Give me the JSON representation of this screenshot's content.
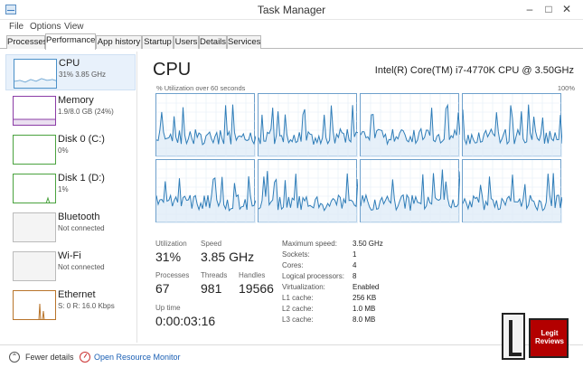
{
  "window": {
    "title": "Task Manager",
    "controls": {
      "minimize": "–",
      "maximize": "□",
      "close": "✕"
    }
  },
  "menu": [
    "File",
    "Options",
    "View"
  ],
  "tabs": [
    "Processes",
    "Performance",
    "App history",
    "Startup",
    "Users",
    "Details",
    "Services"
  ],
  "active_tab": "Performance",
  "sidebar": {
    "items": [
      {
        "name": "CPU",
        "detail": "31% 3.85 GHz",
        "color": "#4a90c8",
        "selected": true
      },
      {
        "name": "Memory",
        "detail": "1.9/8.0 GB (24%)",
        "color": "#8b3ca6",
        "selected": false
      },
      {
        "name": "Disk 0 (C:)",
        "detail": "0%",
        "color": "#4aa23e",
        "selected": false
      },
      {
        "name": "Disk 1 (D:)",
        "detail": "1%",
        "color": "#4aa23e",
        "selected": false
      },
      {
        "name": "Bluetooth",
        "detail": "Not connected",
        "color": "#999999",
        "selected": false
      },
      {
        "name": "Wi-Fi",
        "detail": "Not connected",
        "color": "#999999",
        "selected": false
      },
      {
        "name": "Ethernet",
        "detail": "S: 0 R: 16.0 Kbps",
        "color": "#b8742a",
        "selected": false
      }
    ]
  },
  "cpu": {
    "title": "CPU",
    "model": "Intel(R) Core(TM) i7-4770K CPU @ 3.50GHz",
    "graph_label": "% Utilization over 60 seconds",
    "graph_max": "100%",
    "graph_line_color": "#2f7db8",
    "graph_fill_color": "#dbe9f6",
    "stats": {
      "utilization": {
        "label": "Utilization",
        "value": "31%"
      },
      "speed": {
        "label": "Speed",
        "value": "3.85 GHz"
      },
      "processes": {
        "label": "Processes",
        "value": "67"
      },
      "threads": {
        "label": "Threads",
        "value": "981"
      },
      "handles": {
        "label": "Handles",
        "value": "19566"
      },
      "uptime": {
        "label": "Up time",
        "value": "0:00:03:16"
      }
    },
    "specs": [
      {
        "key": "Maximum speed:",
        "value": "3.50 GHz"
      },
      {
        "key": "Sockets:",
        "value": "1"
      },
      {
        "key": "Cores:",
        "value": "4"
      },
      {
        "key": "Logical processors:",
        "value": "8"
      },
      {
        "key": "Virtualization:",
        "value": "Enabled"
      },
      {
        "key": "L1 cache:",
        "value": "256 KB"
      },
      {
        "key": "L2 cache:",
        "value": "1.0 MB"
      },
      {
        "key": "L3 cache:",
        "value": "8.0 MB"
      }
    ]
  },
  "footer": {
    "fewer_details": "Fewer details",
    "open_resource_monitor": "Open Resource Monitor",
    "fewer_icon": "chevron-up-icon",
    "monitor_icon": "resource-monitor-icon"
  },
  "watermark": {
    "text": "Legit Reviews"
  }
}
